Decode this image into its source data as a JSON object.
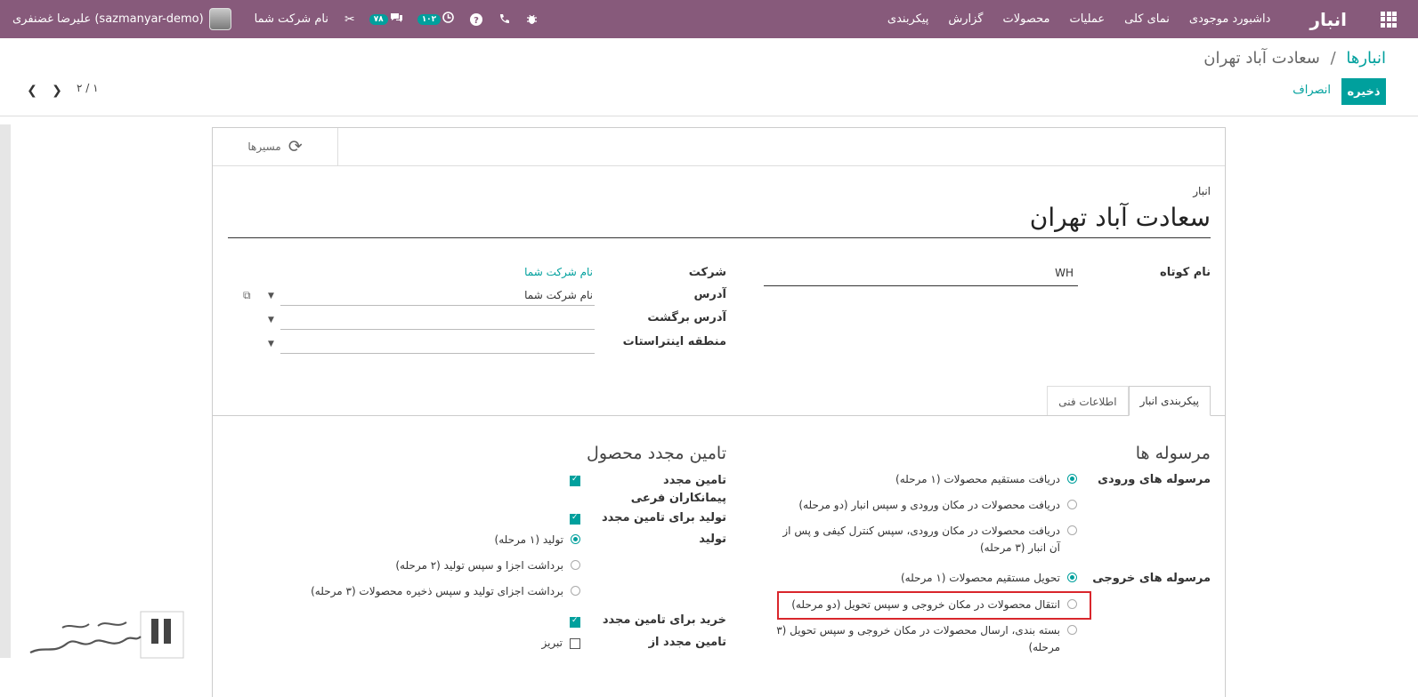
{
  "navbar": {
    "brand": "انبار",
    "menu": [
      "داشبورد موجودی",
      "نمای کلی",
      "عملیات",
      "محصولات",
      "گزارش",
      "پیکربندی"
    ],
    "user_name": "علیرضا غضنفری (sazmanyar-demo)",
    "company": "نام شرکت شما",
    "messages_count": "۷۸",
    "activities_count": "۱۰۲"
  },
  "control": {
    "breadcrumb_parent": "انبارها",
    "breadcrumb_sep": "/",
    "breadcrumb_current": "سعادت آباد تهران",
    "save_label": "ذخیره",
    "discard_label": "انصراف",
    "pager": "۲ / ۱"
  },
  "sheet": {
    "routes_button": "مسیرها",
    "warehouse_label": "انبار",
    "warehouse_name": "سعادت آباد تهران",
    "short_name_label": "نام کوتاه",
    "short_name_value": "WH",
    "company_label": "شرکت",
    "company_value": "نام شرکت شما",
    "address_label": "آدرس",
    "address_value": "نام شرکت شما",
    "return_address_label": "آدرس برگشت",
    "intrastat_label": "منطقه اینتراستات",
    "tabs": [
      "پیکربندی انبار",
      "اطلاعات فنی"
    ],
    "shipments": {
      "title": "مرسوله ها",
      "incoming_label": "مرسوله های ورودی",
      "incoming_options": [
        {
          "label": "دریافت مستقیم محصولات (۱ مرحله)",
          "selected": true
        },
        {
          "label": "دریافت محصولات در مکان ورودی و سپس انبار (دو مرحله)",
          "selected": false
        },
        {
          "label": "دریافت محصولات در مکان ورودی، سپس کنترل کیفی و پس از آن انبار (۳ مرحله)",
          "selected": false
        }
      ],
      "outgoing_label": "مرسوله های خروجی",
      "outgoing_options": [
        {
          "label": "تحویل مستقیم محصولات (۱ مرحله)",
          "selected": true
        },
        {
          "label": "انتقال محصولات در مکان خروجی و سپس تحویل (دو مرحله)",
          "selected": false
        },
        {
          "label": "بسته بندی، ارسال محصولات در مکان خروجی و سپس تحویل (۳ مرحله)",
          "selected": false
        }
      ]
    },
    "resupply": {
      "title": "تامین مجدد محصول",
      "subcontractor_label": "تامین مجدد پیمانکاران فرعی",
      "manufacture_resupply_label": "تولید برای تامین مجدد",
      "manufacture_label": "تولید",
      "manufacture_options": [
        {
          "label": "تولید (۱ مرحله)",
          "selected": true
        },
        {
          "label": "برداشت اجزا و سپس تولید (۲ مرحله)",
          "selected": false
        },
        {
          "label": "برداشت اجزای تولید و سپس ذخیره محصولات (۳ مرحله)",
          "selected": false
        }
      ],
      "buy_resupply_label": "خرید برای تامین مجدد",
      "resupply_from_label": "تامین مجدد از",
      "resupply_from_option": "تبریز"
    }
  },
  "colors": {
    "navbar": "#875a7b",
    "accent": "#00a09d",
    "highlight": "#d9262c"
  }
}
